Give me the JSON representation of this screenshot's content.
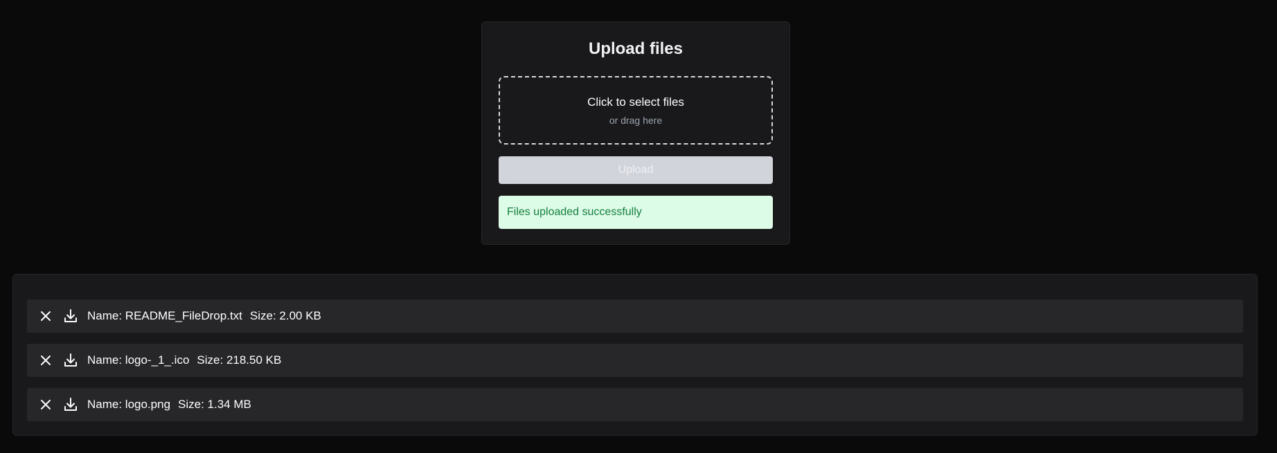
{
  "upload": {
    "title": "Upload files",
    "dropzone_primary": "Click to select files",
    "dropzone_secondary": "or drag here",
    "upload_label": "Upload",
    "status_message": "Files uploaded successfully"
  },
  "files": [
    {
      "name": "Name: README_FileDrop.txt",
      "size": "Size: 2.00 KB"
    },
    {
      "name": "Name: logo-_1_.ico",
      "size": "Size: 218.50 KB"
    },
    {
      "name": "Name: logo.png",
      "size": "Size: 1.34 MB"
    }
  ],
  "icons": {
    "remove": "close-icon",
    "download": "download-icon"
  },
  "colors": {
    "background": "#0a0a0a",
    "card": "#19191b",
    "row": "#27272a",
    "success_bg": "#dcfce7",
    "success_text": "#15803d",
    "disabled_button": "#d1d5db"
  }
}
